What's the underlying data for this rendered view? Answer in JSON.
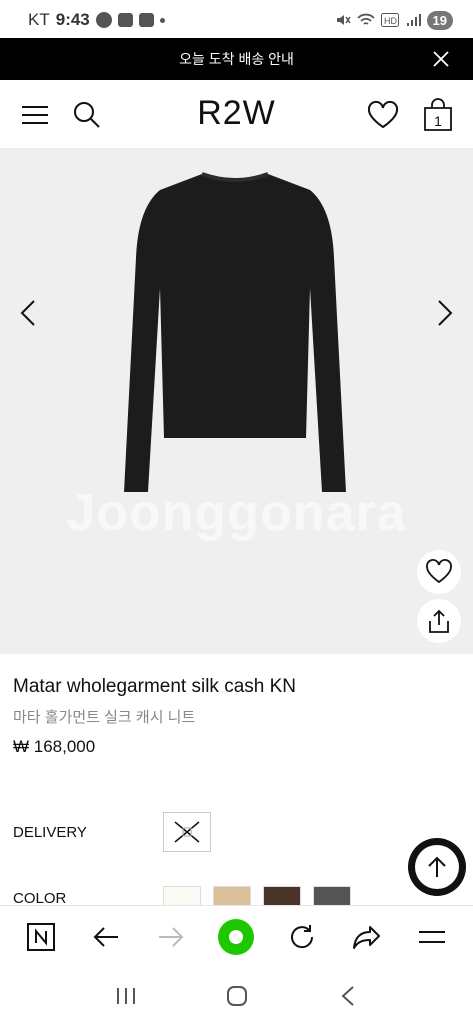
{
  "status_bar": {
    "carrier": "KT",
    "time": "9:43",
    "battery": "19"
  },
  "notice": {
    "text": "오늘 도착 배송 안내"
  },
  "header": {
    "logo": "R2W",
    "cart_count": "1"
  },
  "gallery": {
    "watermark": "Joonggonara"
  },
  "product": {
    "name": "Matar wholegarment silk cash KN",
    "name_ko": "마타 홀가먼트 실크 캐시 니트",
    "price": "₩ 168,000"
  },
  "options": {
    "delivery_label": "DELIVERY",
    "color_label": "COLOR",
    "swatches": [
      "#fbf9f3",
      "#d9bf9a",
      "#4a3329",
      "#555555"
    ]
  },
  "colors": {
    "notice_bg": "#000000",
    "gallery_bg": "#efefef",
    "accent_green": "#1ec800"
  }
}
